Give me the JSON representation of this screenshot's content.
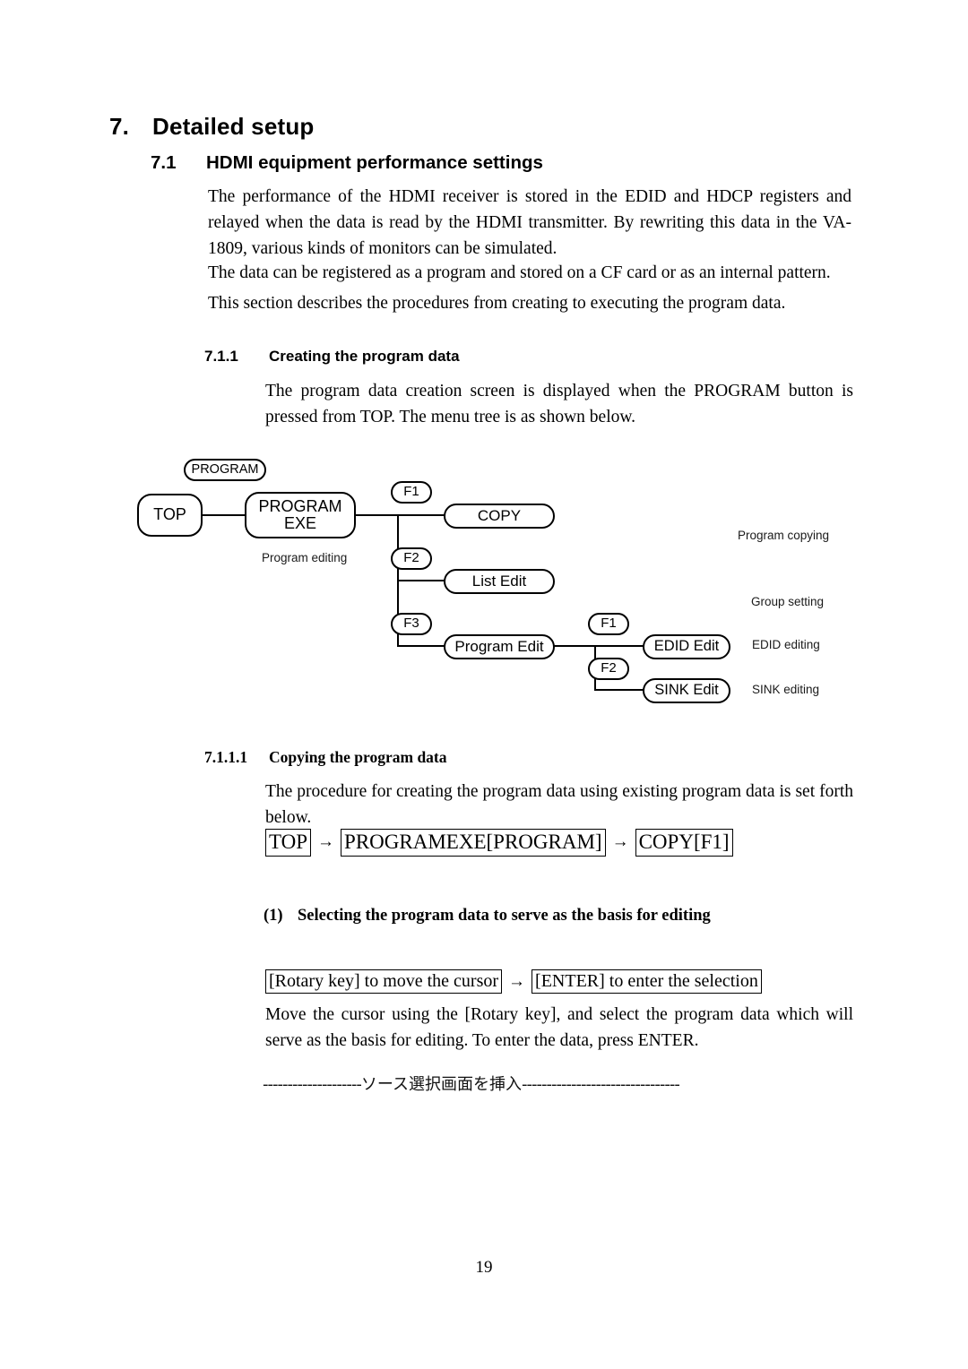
{
  "document": {
    "page_number": "19"
  },
  "headings": {
    "h1_number": "7.",
    "h1_title": "Detailed setup",
    "h2_number": "7.1",
    "h2_title": "HDMI equipment performance settings",
    "h3_number": "7.1.1",
    "h3_title": "Creating the program data",
    "h4_number": "7.1.1.1",
    "h4_title": "Copying the program data",
    "h5_number": "(1)",
    "h5_title": "Selecting the program data to serve as the basis for editing"
  },
  "paragraphs": {
    "intro_1": "The performance of the HDMI receiver is stored in the EDID and HDCP registers and relayed when the data is read by the HDMI transmitter.    By rewriting this data in the VA-1809, various kinds of monitors can be simulated.",
    "intro_2": "The data can be registered as a program and stored on a CF card or as an internal pattern.",
    "intro_3": "This section describes the procedures from creating to executing the program data.",
    "creating_body": "The program data creation screen is displayed when the PROGRAM button is pressed from TOP.    The menu tree is as shown below.",
    "copying_body": "The procedure for creating the program data using existing program data is set forth below.",
    "selecting_body": "Move the cursor using the [Rotary key], and select the program data which will serve as the basis for editing.    To enter the data, press ENTER."
  },
  "menu_tree": {
    "nodes": {
      "program_key": "PROGRAM",
      "top": "TOP",
      "program_exe_line1": "PROGRAM",
      "program_exe_line2": "EXE",
      "f1_a": "F1",
      "f2_a": "F2",
      "f3_a": "F3",
      "copy": "COPY",
      "list_edit": "List Edit",
      "program_edit": "Program Edit",
      "f1_b": "F1",
      "f2_b": "F2",
      "edid_edit": "EDID Edit",
      "sink_edit": "SINK Edit"
    },
    "annotations": {
      "program_editing": "Program editing",
      "program_copying": "Program copying",
      "group_setting": "Group setting",
      "edid_editing": "EDID editing",
      "sink_editing": "SINK editing"
    }
  },
  "key_sequences": {
    "nav_path": {
      "step1": "TOP",
      "arrow1": "→",
      "step2": "PROGRAMEXE[PROGRAM]",
      "arrow2": "→",
      "step3": "COPY[F1]"
    },
    "operation": {
      "step1": "[Rotary key] to move the cursor",
      "arrow1": "→",
      "step2": "[ENTER] to enter the selection"
    }
  },
  "insert_marker": {
    "dashes_left": "--------------------",
    "text": "ソース選択画面を挿入",
    "dashes_right": "--------------------------------"
  }
}
